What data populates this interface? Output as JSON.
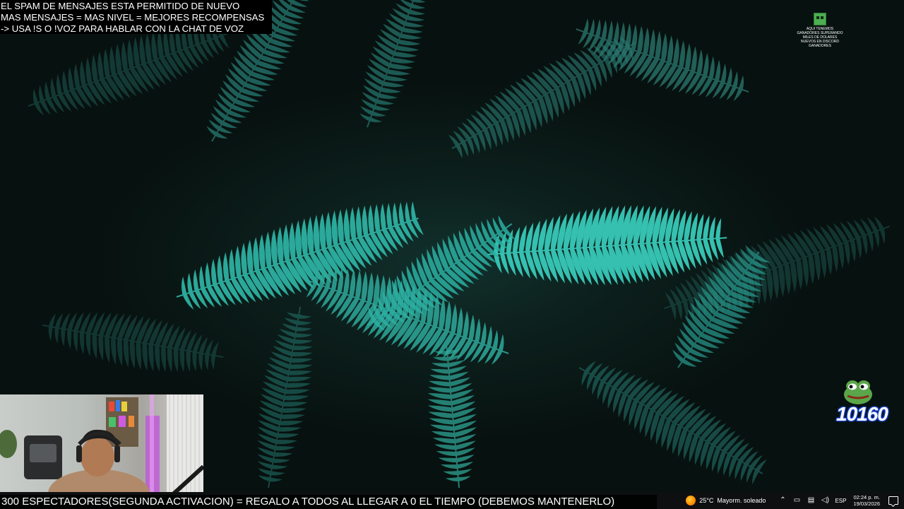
{
  "overlay": {
    "line1": "EL SPAM DE MENSAJES ESTA PERMITIDO DE NUEVO",
    "line2": "MAS MENSAJES = MAS NIVEL = MEJORES RECOMPENSAS",
    "line3": "-> USA !S O !VOZ PARA HABLAR CON LA CHAT DE VOZ"
  },
  "corner_logo": {
    "line1": "AQUI TENEMOS",
    "line2": "GANADORES SUPERANDO",
    "line3": "MILES DE DOLARES",
    "line4": "NUEVOS EN DISCORD",
    "line5": "GANADORES"
  },
  "counter": {
    "value": "10160"
  },
  "ticker": {
    "text": "300 ESPECTADORES(SEGUNDA ACTIVACION) = REGALO A TODOS AL LLEGAR A 0 EL TIEMPO (DEBEMOS MANTENERLO)"
  },
  "tray": {
    "temperature": "25°C",
    "weather": "Mayorm. soleado",
    "language": "ESP",
    "time": "02:24 p. m.",
    "date": "19/03/2026"
  },
  "icons": {
    "weather": "sun-icon",
    "chevron": "chevron-up-icon",
    "network": "network-icon",
    "volume": "volume-icon",
    "notifications": "notification-icon"
  }
}
